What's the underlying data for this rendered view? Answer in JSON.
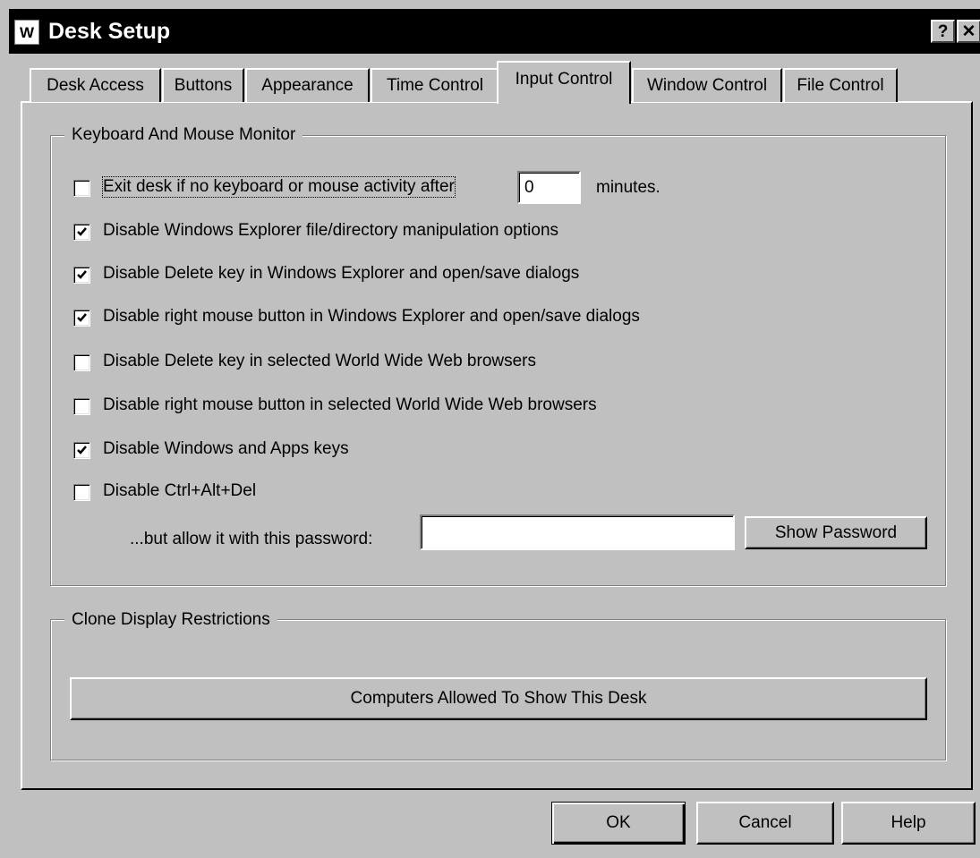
{
  "window": {
    "title": "Desk Setup",
    "icon": "w-app-icon",
    "icon_letter": "W",
    "help_glyph": "?",
    "close_glyph": "✕"
  },
  "tabs": [
    {
      "label": "Desk Access",
      "active": false
    },
    {
      "label": "Buttons",
      "active": false
    },
    {
      "label": "Appearance",
      "active": false
    },
    {
      "label": "Time Control",
      "active": false
    },
    {
      "label": "Input Control",
      "active": true
    },
    {
      "label": "Window Control",
      "active": false
    },
    {
      "label": "File Control",
      "active": false
    }
  ],
  "keyboard_group": {
    "title": "Keyboard And Mouse Monitor",
    "exit_option": {
      "label": "Exit desk if no keyboard or mouse activity after",
      "checked": false,
      "minutes_value": "0",
      "minutes_suffix": "minutes."
    },
    "options": [
      {
        "label": "Disable Windows Explorer file/directory manipulation options",
        "checked": true
      },
      {
        "label": "Disable Delete key in Windows Explorer and open/save dialogs",
        "checked": true
      },
      {
        "label": "Disable right mouse button in Windows Explorer and open/save dialogs",
        "checked": true
      },
      {
        "label": "Disable Delete key in selected World Wide Web browsers",
        "checked": false
      },
      {
        "label": "Disable right mouse button in selected World Wide Web browsers",
        "checked": false
      },
      {
        "label": "Disable Windows and Apps keys",
        "checked": true
      },
      {
        "label": "Disable Ctrl+Alt+Del",
        "checked": false
      }
    ],
    "password_label": "...but allow it with this password:",
    "password_value": "",
    "show_password_label": "Show Password"
  },
  "clone_group": {
    "title": "Clone Display Restrictions",
    "computers_button_label": "Computers Allowed To Show This Desk"
  },
  "footer": {
    "ok_label": "OK",
    "cancel_label": "Cancel",
    "help_label": "Help"
  },
  "colors": {
    "face": "#c0c0c0",
    "titlebar": "#000000",
    "title_text": "#ffffff"
  }
}
